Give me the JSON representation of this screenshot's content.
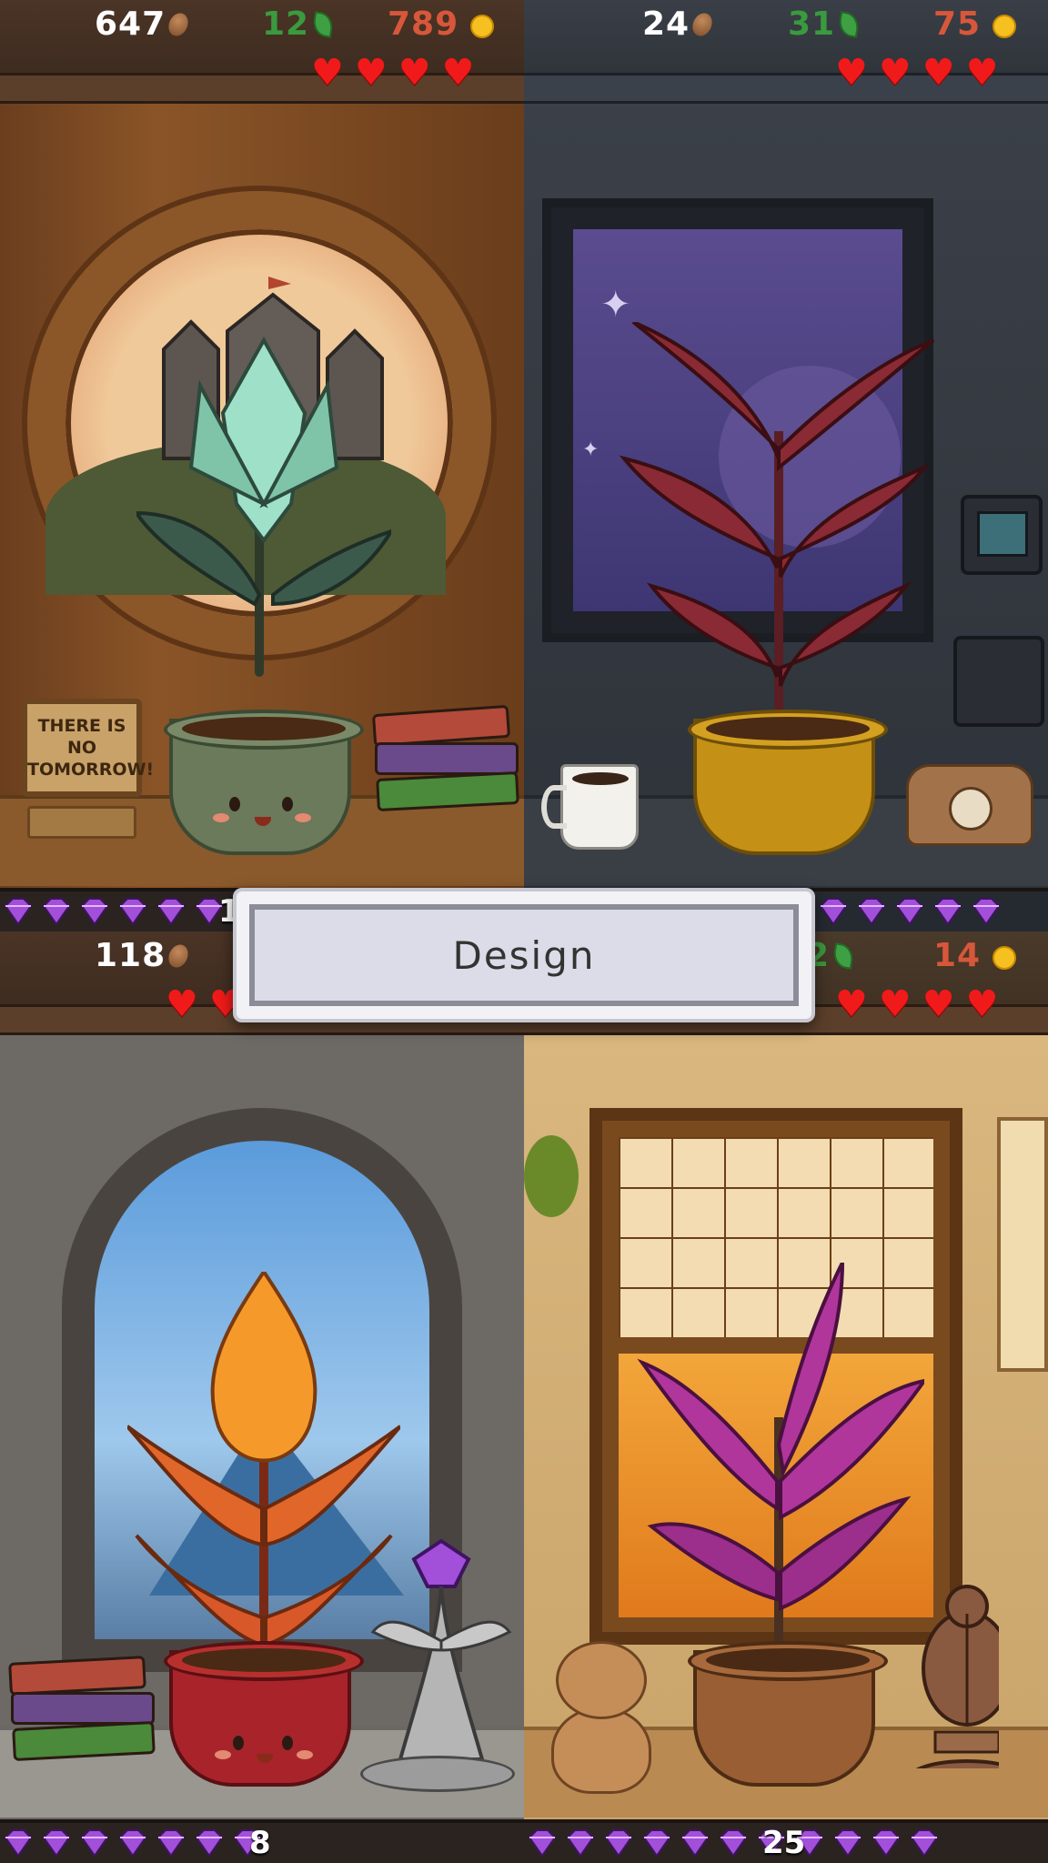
{
  "panels": [
    {
      "coins": "647",
      "leaves": "12",
      "suns": "789",
      "hearts": 4,
      "gems": 6,
      "bottom_count": "1",
      "sign_text": "THERE IS NO TOMORROW!",
      "theme": "castle-round-window"
    },
    {
      "coins": "24",
      "leaves": "31",
      "suns": "75",
      "hearts": 4,
      "gems": 5,
      "bottom_count": "",
      "theme": "space-station-window"
    },
    {
      "coins": "118",
      "leaves": "",
      "suns": "",
      "hearts": 2,
      "gems": 7,
      "bottom_count": "8",
      "theme": "stone-arch-mountains"
    },
    {
      "coins": "",
      "leaves": "2",
      "suns": "14",
      "hearts": 4,
      "gems": 11,
      "bottom_count": "25",
      "theme": "japanese-autumn-window"
    }
  ],
  "overlay": {
    "label": "Design"
  },
  "icons": {
    "coin": "seed-icon",
    "leaf": "leaf-icon",
    "sun": "sun-icon",
    "heart": "heart-icon",
    "gem": "amethyst-gem-icon"
  },
  "colors": {
    "coins": "#ffffff",
    "leaves": "#3a9a3e",
    "suns": "#d8573a",
    "heart": "#f11a1a",
    "gem": "#a24fd9"
  }
}
